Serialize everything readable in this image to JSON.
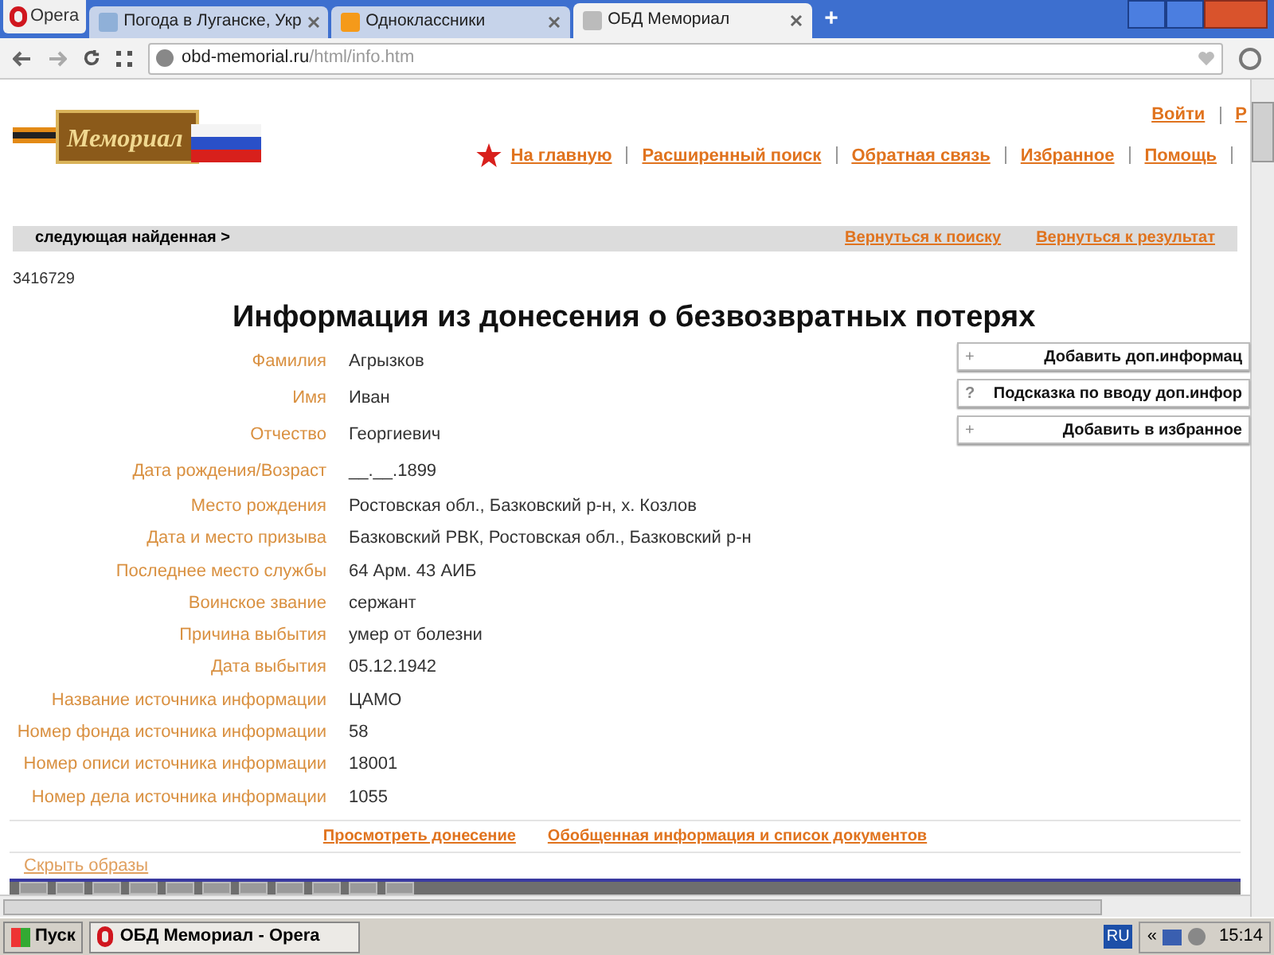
{
  "browser": {
    "menu_label": "Opera",
    "tabs": [
      {
        "title": "Погода в Луганске, Укр",
        "selected": false
      },
      {
        "title": "Одноклассники",
        "selected": false
      },
      {
        "title": "ОБД Мемориал",
        "selected": true
      }
    ],
    "new_tab": "+",
    "address": {
      "host": "obd-memorial.ru",
      "path": "/html/info.htm"
    }
  },
  "header": {
    "logo_text": "Мемориал",
    "login_links": [
      "Войти",
      "Р"
    ],
    "nav": [
      "На главную",
      "Расширенный поиск",
      "Обратная связь",
      "Избранное",
      "Помощь"
    ]
  },
  "nav_bar": {
    "next": "следующая найденная >",
    "links": [
      "Вернуться к поиску",
      "Вернуться к результат"
    ]
  },
  "record_id": "3416729",
  "title": "Информация из донесения о безвозвратных потерях",
  "actions": [
    {
      "kind": "add",
      "icon": "+",
      "label": "Добавить доп.информац"
    },
    {
      "kind": "hint",
      "icon": "?",
      "label": "Подсказка по вводу доп.инфор"
    },
    {
      "kind": "add",
      "icon": "+",
      "label": "Добавить в избранное"
    }
  ],
  "fields": [
    {
      "label": "Фамилия",
      "value": "Агрызков"
    },
    {
      "label": "Имя",
      "value": "Иван"
    },
    {
      "label": "Отчество",
      "value": "Георгиевич"
    },
    {
      "label": "Дата рождения/Возраст",
      "value": "__.__.1899"
    },
    {
      "label": "Место рождения",
      "value": "Ростовская обл., Базковский р-н, х. Козлов"
    },
    {
      "label": "Дата и место призыва",
      "value": "Базковский РВК, Ростовская обл., Базковский р-н"
    },
    {
      "label": "Последнее место службы",
      "value": "64 Арм. 43 АИБ"
    },
    {
      "label": "Воинское звание",
      "value": "сержант"
    },
    {
      "label": "Причина выбытия",
      "value": "умер от болезни"
    },
    {
      "label": "Дата выбытия",
      "value": "05.12.1942"
    },
    {
      "label": "Название источника информации",
      "value": "ЦАМО"
    },
    {
      "label": "Номер фонда источника информации",
      "value": "58"
    },
    {
      "label": "Номер описи источника информации",
      "value": "18001"
    },
    {
      "label": "Номер дела источника информации",
      "value": "1055"
    }
  ],
  "bottom_links": [
    "Просмотреть донесение",
    "Обобщенная информация и список документов"
  ],
  "hide_images": "Скрыть образы",
  "taskbar": {
    "start": "Пуск",
    "task": "ОБД Мемориал - Opera",
    "language": "RU",
    "tray_arrow": "«",
    "clock": "15:14"
  }
}
